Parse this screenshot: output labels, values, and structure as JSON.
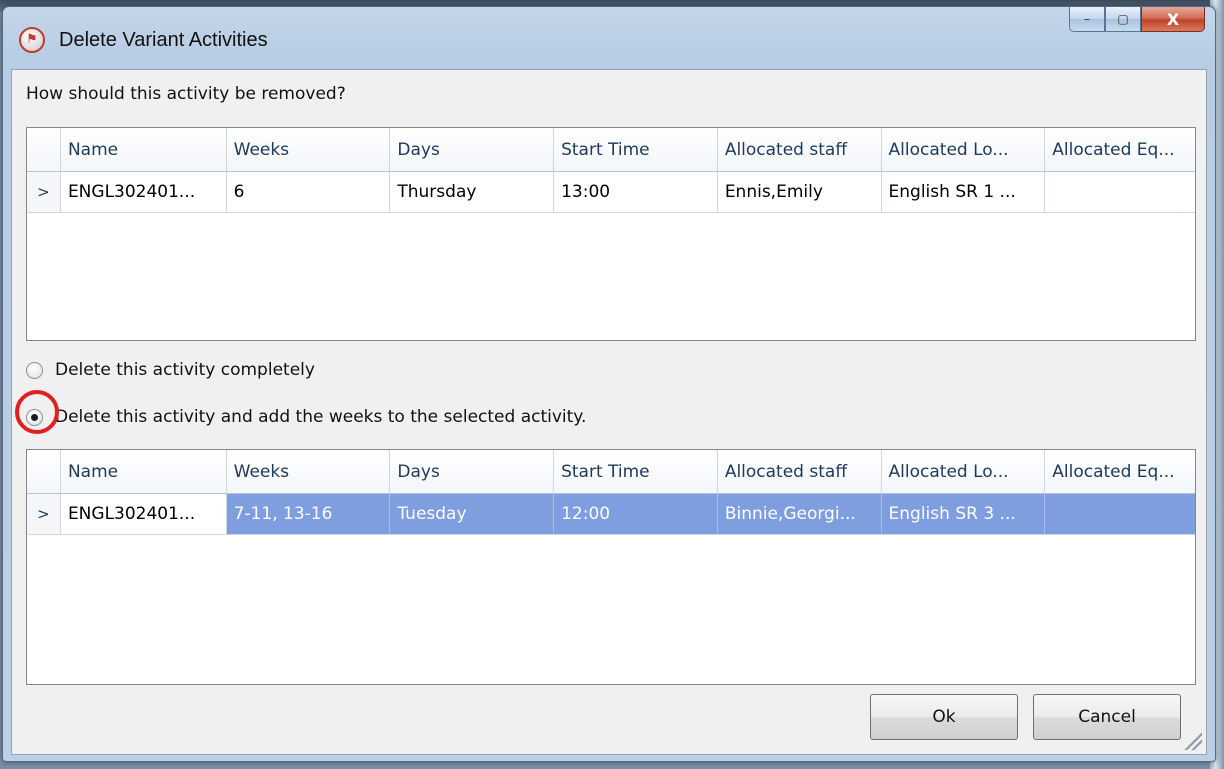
{
  "window": {
    "title": "Delete Variant Activities",
    "app_icon_glyph": "⚑",
    "caption": {
      "minimize": "–",
      "maximize": "▢",
      "close": "X"
    }
  },
  "prompt": "How should this activity be removed?",
  "columns": [
    "Name",
    "Weeks",
    "Days",
    "Start Time",
    "Allocated staff",
    "Allocated Lo...",
    "Allocated Eq..."
  ],
  "row_indicator": ">",
  "top_grid": {
    "rows": [
      {
        "name": "ENGL302401...",
        "weeks": "6",
        "days": "Thursday",
        "start_time": "13:00",
        "staff": "Ennis,Emily",
        "location": "English SR 1 ...",
        "equipment": ""
      }
    ]
  },
  "options": {
    "delete_completely": {
      "label": "Delete this activity completely",
      "checked": false
    },
    "delete_and_merge": {
      "label": "Delete this activity and add the weeks to the selected activity.",
      "checked": true
    }
  },
  "bottom_grid": {
    "rows": [
      {
        "name": "ENGL302401...",
        "weeks": "7-11, 13-16",
        "days": "Tuesday",
        "start_time": "12:00",
        "staff": "Binnie,Georgi...",
        "location": "English SR 3 ...",
        "equipment": "",
        "selected": true
      }
    ]
  },
  "buttons": {
    "ok": "Ok",
    "cancel": "Cancel"
  },
  "colors": {
    "selection": "#7f9ee0",
    "highlight_ring": "#e02020",
    "close_button": "#c0432a"
  }
}
